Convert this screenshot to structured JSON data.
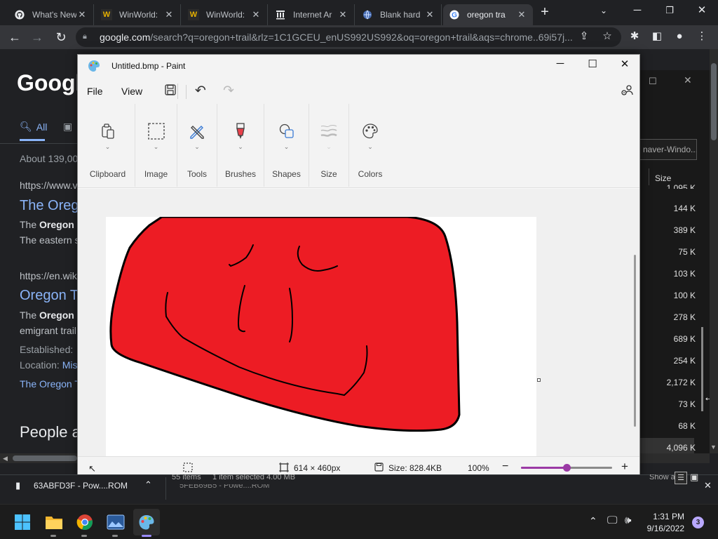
{
  "chrome": {
    "tabs": [
      {
        "title": "What's New",
        "favicon": "github-icon",
        "active": false
      },
      {
        "title": "WinWorld:",
        "favicon": "winworld-icon",
        "active": false
      },
      {
        "title": "WinWorld:",
        "favicon": "winworld-icon",
        "active": false
      },
      {
        "title": "Internet Ar",
        "favicon": "archive-icon",
        "active": false
      },
      {
        "title": "Blank hard",
        "favicon": "globe-icon",
        "active": false
      },
      {
        "title": "oregon tra",
        "favicon": "google-icon",
        "active": true
      }
    ],
    "url_host": "google.com",
    "url_rest": "/search?q=oregon+trail&rlz=1C1GCEU_enUS992US992&oq=oregon+trail&aqs=chrome..69i57j..."
  },
  "google": {
    "logo": "Google",
    "tab_all": "All",
    "about": "About 139,00",
    "result1_url": "https://www.v",
    "result1_title": "The Oreg",
    "result1_snippet_a": "The",
    "result1_snippet_bold": "Oregon",
    "result1_snippet_b": "The eastern s",
    "result2_url": "https://en.wik",
    "result2_title": "Oregon T",
    "result2_snippet_a": "The",
    "result2_snippet_bold": "Oregon",
    "result2_snippet_b": "emigrant trail",
    "established": "Established:",
    "location_label": "Location:",
    "location_val": "Mis",
    "more_link": "The Oregon T",
    "people_also": "People a"
  },
  "bgwindow": {
    "search_text": "naver-Windo...",
    "col_header": "Size",
    "sizes": [
      "1,095 K",
      "144 K",
      "389 K",
      "75 K",
      "103 K",
      "100 K",
      "278 K",
      "689 K",
      "254 K",
      "2,172 K",
      "73 K",
      "68 K",
      "4,096 K"
    ],
    "status_items": "55 items",
    "status_selected": "1 item selected  4.00 MB",
    "show_all": "Show all"
  },
  "paint": {
    "title": "Untitled.bmp - Paint",
    "menu_file": "File",
    "menu_view": "View",
    "groups": [
      "Clipboard",
      "Image",
      "Tools",
      "Brushes",
      "Shapes",
      "Size",
      "Colors"
    ],
    "dimensions": "614 × 460px",
    "filesize": "Size: 828.4KB",
    "zoom": "100%",
    "zoom_level": 0.5,
    "fill_color": "#ed1c24"
  },
  "downloads": {
    "file1": "63ABFD3F - Pow....ROM",
    "file2": "5FEB69B5 - Powe....ROM"
  },
  "taskbar": {
    "time": "1:31 PM",
    "date": "9/16/2022",
    "badge": "3"
  }
}
